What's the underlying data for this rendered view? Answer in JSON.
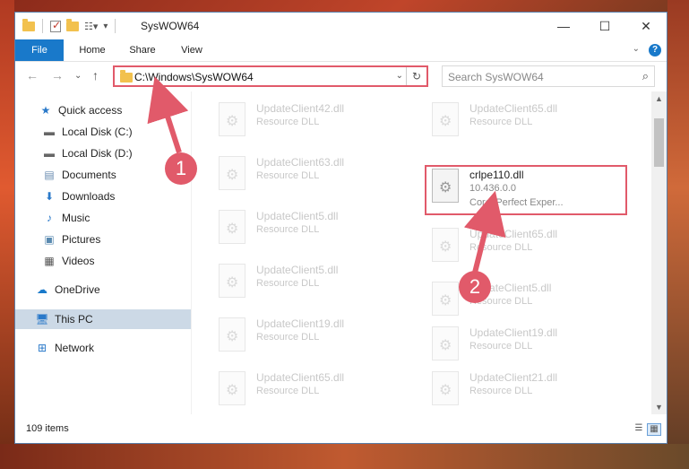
{
  "window": {
    "title": "SysWOW64"
  },
  "ribbon": {
    "tabs": [
      "File",
      "Home",
      "Share",
      "View"
    ]
  },
  "address": {
    "path": "C:\\Windows\\SysWOW64"
  },
  "search": {
    "placeholder": "Search SysWOW64"
  },
  "sidebar": {
    "items": [
      {
        "label": "Quick access",
        "icon": "star-icon"
      },
      {
        "label": "Local Disk (C:)",
        "icon": "drive-icon",
        "pinned": true
      },
      {
        "label": "Local Disk (D:)",
        "icon": "drive-icon"
      },
      {
        "label": "Documents",
        "icon": "document-icon"
      },
      {
        "label": "Downloads",
        "icon": "download-icon",
        "pinned": true
      },
      {
        "label": "Music",
        "icon": "music-icon",
        "pinned": true
      },
      {
        "label": "Pictures",
        "icon": "picture-icon",
        "pinned": true
      },
      {
        "label": "Videos",
        "icon": "video-icon",
        "pinned": true
      },
      {
        "label": "OneDrive",
        "icon": "cloud-icon"
      },
      {
        "label": "This PC",
        "icon": "computer-icon",
        "selected": true
      },
      {
        "label": "Network",
        "icon": "network-icon"
      }
    ]
  },
  "files": {
    "left": [
      {
        "name": "UpdateClient42.dll",
        "type": "Resource DLL"
      },
      {
        "name": "UpdateClient63.dll",
        "type": "Resource DLL"
      },
      {
        "name": "UpdateClient5.dll",
        "type": "Resource DLL"
      },
      {
        "name": "UpdateClient5.dll",
        "type": "Resource DLL"
      },
      {
        "name": "UpdateClient19.dll",
        "type": "Resource DLL"
      },
      {
        "name": "UpdateClient65.dll",
        "type": "Resource DLL"
      }
    ],
    "right": [
      {
        "name": "UpdateClient65.dll",
        "type": "Resource DLL"
      },
      {
        "name": "crlpe110.dll",
        "version": "10.436.0.0",
        "type": "Corel Perfect Exper..."
      },
      {
        "name": "UpdateClient65.dll",
        "type": "Resource DLL"
      },
      {
        "name": "UpdateClient5.dll",
        "type": "Resource DLL"
      },
      {
        "name": "UpdateClient19.dll",
        "type": "Resource DLL"
      },
      {
        "name": "UpdateClient21.dll",
        "type": "Resource DLL"
      }
    ]
  },
  "status": {
    "item_count": "109 items"
  },
  "callouts": {
    "first": "1",
    "second": "2"
  },
  "colors": {
    "accent": "#1979ca",
    "highlight": "#e15a6a"
  }
}
